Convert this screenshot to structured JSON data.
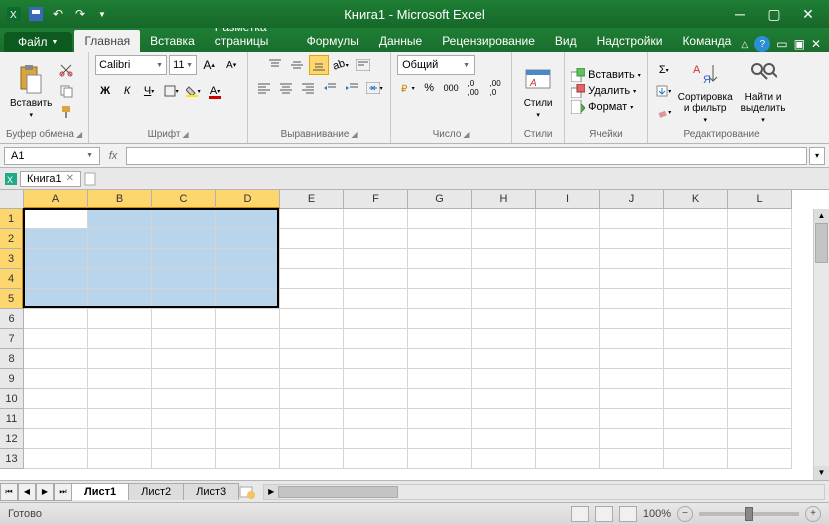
{
  "title": "Книга1 - Microsoft Excel",
  "tabs": {
    "file": "Файл",
    "items": [
      "Главная",
      "Вставка",
      "Разметка страницы",
      "Формулы",
      "Данные",
      "Рецензирование",
      "Вид",
      "Надстройки",
      "Команда"
    ],
    "active_index": 0
  },
  "ribbon": {
    "clipboard": {
      "paste": "Вставить",
      "label": "Буфер обмена"
    },
    "font": {
      "name": "Calibri",
      "size": "11",
      "label": "Шрифт"
    },
    "alignment": {
      "label": "Выравнивание"
    },
    "number": {
      "format": "Общий",
      "label": "Число"
    },
    "styles": {
      "btn": "Стили",
      "label": "Стили"
    },
    "cells": {
      "insert": "Вставить",
      "delete": "Удалить",
      "format": "Формат",
      "label": "Ячейки"
    },
    "editing": {
      "sort": "Сортировка\nи фильтр",
      "find": "Найти и\nвыделить",
      "label": "Редактирование"
    }
  },
  "namebox": "A1",
  "doc_tab": "Книга1",
  "columns": [
    "A",
    "B",
    "C",
    "D",
    "E",
    "F",
    "G",
    "H",
    "I",
    "J",
    "K",
    "L"
  ],
  "rows": [
    "1",
    "2",
    "3",
    "4",
    "5",
    "6",
    "7",
    "8",
    "9",
    "10",
    "11",
    "12",
    "13"
  ],
  "selection": {
    "col_start": 0,
    "col_end": 3,
    "row_start": 0,
    "row_end": 4
  },
  "sheets": [
    "Лист1",
    "Лист2",
    "Лист3"
  ],
  "active_sheet": 0,
  "status": "Готово",
  "zoom": "100%"
}
